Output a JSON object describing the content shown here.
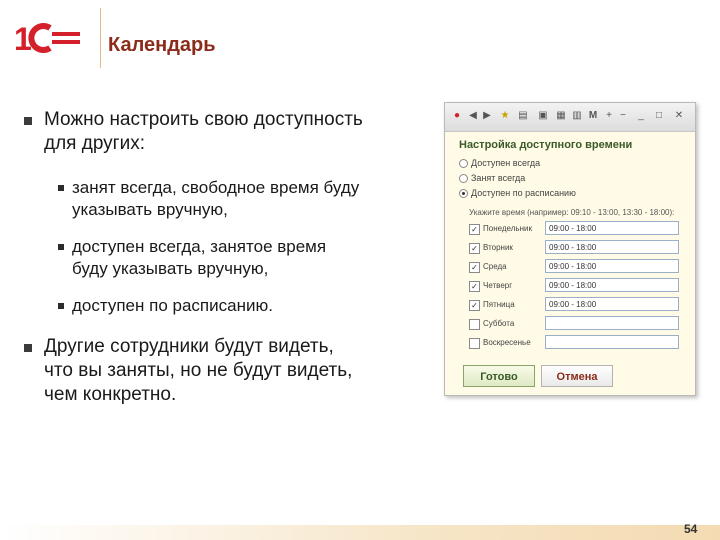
{
  "header": {
    "title": "Календарь",
    "logo_text": "1С"
  },
  "bullets": [
    {
      "text_l1": "Можно настроить свою доступность",
      "text_l2": "для других:"
    },
    {
      "text_l1": "Другие сотрудники будут видеть,",
      "text_l2": "что вы заняты, но не будут видеть,",
      "text_l3": "чем конкретно."
    }
  ],
  "subbullets": [
    {
      "l1": "занят всегда, свободное время буду",
      "l2": "указывать вручную,"
    },
    {
      "l1": "доступен всегда, занятое время",
      "l2": "буду указывать вручную,"
    },
    {
      "l1": "доступен по расписанию."
    }
  ],
  "dialog": {
    "title": "Настройка доступного времени",
    "options": [
      "Доступен всегда",
      "Занят всегда",
      "Доступен по расписанию"
    ],
    "selected_option": 2,
    "hint": "Укажите время (например: 09:10 - 13:00, 13:30 - 18:00):",
    "days": [
      {
        "name": "Понедельник",
        "checked": true,
        "time": "09:00 - 18:00"
      },
      {
        "name": "Вторник",
        "checked": true,
        "time": "09:00 - 18:00"
      },
      {
        "name": "Среда",
        "checked": true,
        "time": "09:00 - 18:00"
      },
      {
        "name": "Четверг",
        "checked": true,
        "time": "09:00 - 18:00"
      },
      {
        "name": "Пятница",
        "checked": true,
        "time": "09:00 - 18:00"
      },
      {
        "name": "Суббота",
        "checked": false,
        "time": ""
      },
      {
        "name": "Воскресенье",
        "checked": false,
        "time": ""
      }
    ],
    "ok_label": "Готово",
    "cancel_label": "Отмена",
    "toolbar_m": "М"
  },
  "footer": {
    "page_number": "54"
  },
  "colors": {
    "brand_red": "#d4202a",
    "title": "#8b2b1a",
    "dialog_bg": "#fffbe6"
  }
}
